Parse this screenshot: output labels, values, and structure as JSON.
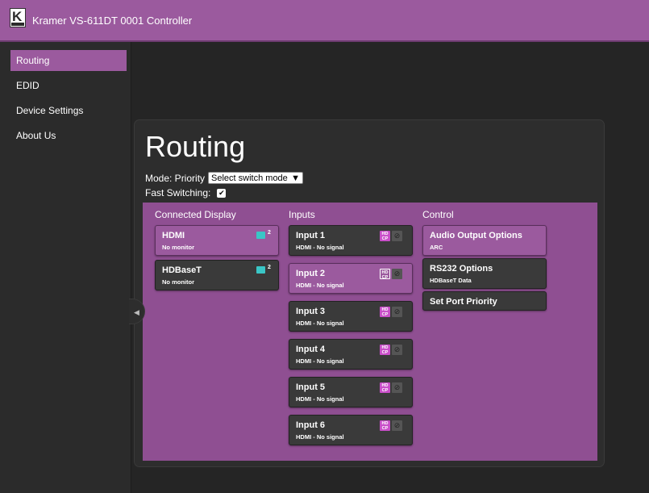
{
  "header": {
    "title": "Kramer VS-611DT 0001 Controller",
    "logo_letter": "K"
  },
  "sidebar": {
    "items": [
      {
        "label": "Routing",
        "active": true
      },
      {
        "label": "EDID",
        "active": false
      },
      {
        "label": "Device Settings",
        "active": false
      },
      {
        "label": "About Us",
        "active": false
      }
    ]
  },
  "page": {
    "title": "Routing",
    "mode_label": "Mode: Priority",
    "mode_select_value": "Select switch mode",
    "fast_switching_label": "Fast Switching:",
    "fast_switching_checked": true
  },
  "columns": {
    "connected_display": "Connected Display",
    "inputs": "Inputs",
    "control": "Control"
  },
  "displays": [
    {
      "name": "HDMI",
      "status": "No monitor",
      "count": "2",
      "selected": true
    },
    {
      "name": "HDBaseT",
      "status": "No monitor",
      "count": "2",
      "selected": false
    }
  ],
  "inputs": [
    {
      "name": "Input 1",
      "status": "HDMI - No signal",
      "hdcp": "HD CP",
      "selected": false
    },
    {
      "name": "Input 2",
      "status": "HDMI - No signal",
      "hdcp": "HD CP",
      "selected": true
    },
    {
      "name": "Input 3",
      "status": "HDMI - No signal",
      "hdcp": "HD CP",
      "selected": false
    },
    {
      "name": "Input 4",
      "status": "HDMI - No signal",
      "hdcp": "HD CP",
      "selected": false
    },
    {
      "name": "Input 5",
      "status": "HDMI - No signal",
      "hdcp": "HD CP",
      "selected": false
    },
    {
      "name": "Input 6",
      "status": "HDMI - No signal",
      "hdcp": "HD CP",
      "selected": false
    }
  ],
  "controls": [
    {
      "name": "Audio Output Options",
      "sub": "ARC",
      "selected": true
    },
    {
      "name": "RS232 Options",
      "sub": "HDBaseT Data",
      "selected": false
    },
    {
      "name": "Set Port Priority",
      "sub": "",
      "selected": false
    }
  ],
  "colors": {
    "accent": "#9b5a9e",
    "routing_area": "#8f4f92",
    "hdcp_badge": "#c94fc9",
    "monitor_icon": "#3ac6c6"
  }
}
